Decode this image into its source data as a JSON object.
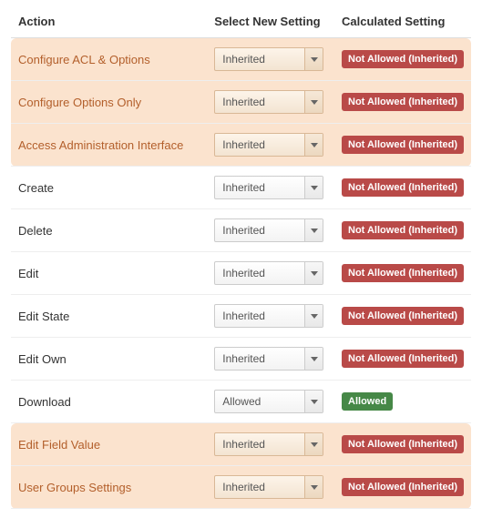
{
  "headers": {
    "action": "Action",
    "select": "Select New Setting",
    "calc": "Calculated Setting"
  },
  "badges": {
    "not_allowed_inherited": "Not Allowed (Inherited)",
    "allowed": "Allowed"
  },
  "select_labels": {
    "inherited": "Inherited",
    "allowed": "Allowed"
  },
  "rows": [
    {
      "action": "Configure ACL & Options",
      "select": "inherited",
      "calc": "not_allowed_inherited",
      "group": "a"
    },
    {
      "action": "Configure Options Only",
      "select": "inherited",
      "calc": "not_allowed_inherited",
      "group": "a"
    },
    {
      "action": "Access Administration Interface",
      "select": "inherited",
      "calc": "not_allowed_inherited",
      "group": "a"
    },
    {
      "action": "Create",
      "select": "inherited",
      "calc": "not_allowed_inherited",
      "group": null
    },
    {
      "action": "Delete",
      "select": "inherited",
      "calc": "not_allowed_inherited",
      "group": null
    },
    {
      "action": "Edit",
      "select": "inherited",
      "calc": "not_allowed_inherited",
      "group": null
    },
    {
      "action": "Edit State",
      "select": "inherited",
      "calc": "not_allowed_inherited",
      "group": null
    },
    {
      "action": "Edit Own",
      "select": "inherited",
      "calc": "not_allowed_inherited",
      "group": null
    },
    {
      "action": "Download",
      "select": "allowed",
      "calc": "allowed",
      "group": null
    },
    {
      "action": "Edit Field Value",
      "select": "inherited",
      "calc": "not_allowed_inherited",
      "group": "b"
    },
    {
      "action": "User Groups Settings",
      "select": "inherited",
      "calc": "not_allowed_inherited",
      "group": "b"
    }
  ],
  "colors": {
    "badge_red": "#b94a48",
    "badge_green": "#468847",
    "highlight_bg": "#fbe3ce",
    "highlight_text": "#b35f2b"
  }
}
